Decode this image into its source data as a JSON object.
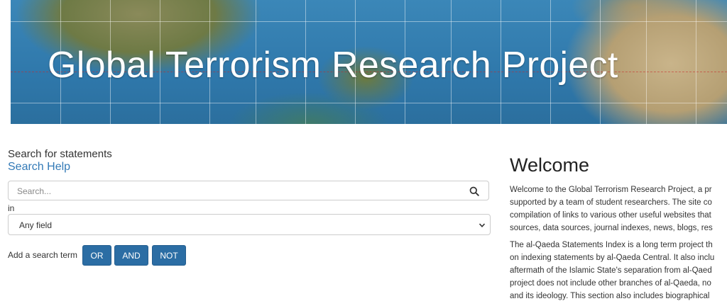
{
  "banner": {
    "title": "Global Terrorism Research Project"
  },
  "search": {
    "heading": "Search for statements",
    "help_link": "Search Help",
    "placeholder": "Search...",
    "in_label": "in",
    "field_value": "Any field",
    "add_term_label": "Add a search term",
    "buttons": {
      "or": "OR",
      "and": "AND",
      "not": "NOT"
    }
  },
  "welcome": {
    "title": "Welcome",
    "para1": [
      "Welcome to the Global Terrorism Research Project, a pr",
      "supported by a team of student researchers. The site co",
      "compilation of links to various other useful websites that",
      "sources, data sources, journal indexes, news, blogs, res"
    ],
    "para2": [
      "The al-Qaeda Statements Index is a long term project th",
      "on indexing statements by al-Qaeda Central. It also inclu",
      "aftermath of the Islamic State's separation from al-Qaed",
      "project does not include other branches of al-Qaeda, no",
      "and its ideology. This section also includes biographical"
    ]
  },
  "colors": {
    "link": "#337ab7",
    "button": "#2b6da4",
    "banner_ocean": "#2f78ab"
  }
}
